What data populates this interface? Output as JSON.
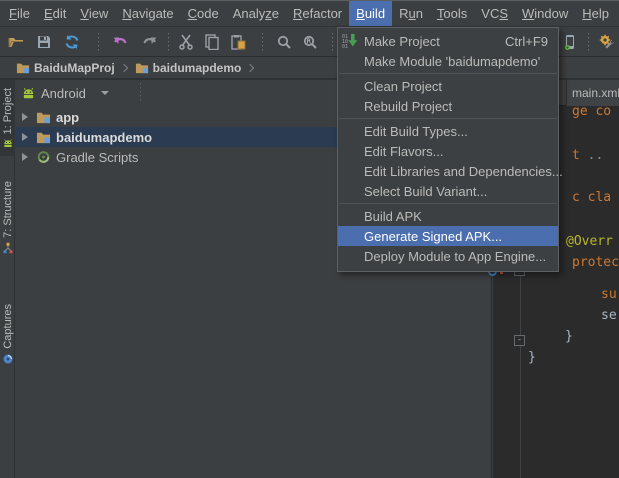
{
  "menubar": {
    "items": [
      {
        "pre": "",
        "mn": "F",
        "post": "ile"
      },
      {
        "pre": "",
        "mn": "E",
        "post": "dit"
      },
      {
        "pre": "",
        "mn": "V",
        "post": "iew"
      },
      {
        "pre": "",
        "mn": "N",
        "post": "avigate"
      },
      {
        "pre": "",
        "mn": "C",
        "post": "ode"
      },
      {
        "pre": "Analy",
        "mn": "z",
        "post": "e"
      },
      {
        "pre": "",
        "mn": "R",
        "post": "efactor"
      },
      {
        "pre": "",
        "mn": "B",
        "post": "uild"
      },
      {
        "pre": "R",
        "mn": "u",
        "post": "n"
      },
      {
        "pre": "",
        "mn": "T",
        "post": "ools"
      },
      {
        "pre": "VC",
        "mn": "S",
        "post": ""
      },
      {
        "pre": "",
        "mn": "W",
        "post": "indow"
      },
      {
        "pre": "",
        "mn": "H",
        "post": "elp"
      }
    ],
    "active_item": "Build"
  },
  "toolbar": {
    "icons": [
      "open-folder",
      "save-all",
      "synchronize",
      "undo",
      "redo",
      "cut",
      "copy",
      "paste",
      "find",
      "replace",
      "back",
      "forward",
      "avd-manager",
      "sdk-manager"
    ]
  },
  "breadcrumb": {
    "items": [
      "BaiduMapProj",
      "baidumapdemo"
    ]
  },
  "build_menu": {
    "rows": [
      {
        "label": "Make Project",
        "shortcut": "Ctrl+F9"
      },
      {
        "label": "Make Module 'baidumapdemo'"
      },
      {
        "label": "Clean Project"
      },
      {
        "label": "Rebuild Project"
      },
      {
        "label": "Edit Build Types..."
      },
      {
        "label": "Edit Flavors..."
      },
      {
        "label": "Edit Libraries and Dependencies..."
      },
      {
        "label": "Select Build Variant..."
      },
      {
        "label": "Build APK"
      },
      {
        "label": "Generate Signed APK...",
        "selected": true
      },
      {
        "label": "Deploy Module to App Engine..."
      }
    ]
  },
  "tool_stripe": {
    "items": [
      {
        "label": "1: Project",
        "active": true
      },
      {
        "label": "7: Structure"
      },
      {
        "label": "Captures"
      }
    ]
  },
  "project_panel": {
    "view_selector": "Android",
    "tree": [
      {
        "label": "app",
        "bold": true
      },
      {
        "label": "baidumapdemo",
        "bold": true,
        "selected": true
      },
      {
        "label": "Gradle Scripts"
      }
    ]
  },
  "editor": {
    "tab": "main.xml",
    "fold_glyph": "-",
    "code": [
      {
        "a": "ge co",
        "note": "end of 'package com' clipped by menu"
      },
      {
        "a": "t ",
        "b": ".."
      },
      {
        "a": "c cla"
      },
      {
        "a": "@Overr"
      },
      {
        "a": "protec"
      },
      {
        "a": "su"
      },
      {
        "a": "se"
      },
      {
        "a": "}"
      },
      {
        "a": "}"
      }
    ]
  },
  "colors": {
    "chrome_bg": "#3C3F41",
    "editor_bg": "#2B2B2B",
    "menu_selection": "#4B6EAF",
    "tree_selection": "#2B3B52",
    "keyword_orange": "#CC7832",
    "annotation_yellow": "#BBB529",
    "code_gray": "#A9B7C6"
  }
}
